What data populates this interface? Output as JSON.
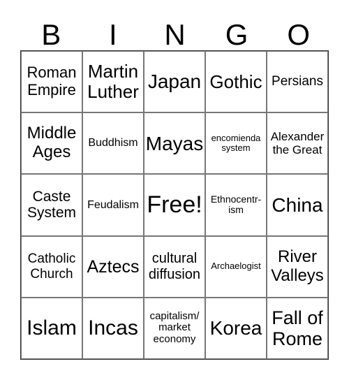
{
  "header": [
    "B",
    "I",
    "N",
    "G",
    "O"
  ],
  "cells": [
    "Roman\nEmpire",
    "Martin\nLuther",
    "Japan",
    "Gothic",
    "Persians",
    "Middle\nAges",
    "Buddhism",
    "Mayas",
    "encomienda\nsystem",
    "Alexander\nthe Great",
    "Caste\nSystem",
    "Feudalism",
    "Free!",
    "Ethnocentr-\nism",
    "China",
    "Catholic\nChurch",
    "Aztecs",
    "cultural\ndiffusion",
    "Archaelogist",
    "River\nValleys",
    "Islam",
    "Incas",
    "capitalism/\nmarket\neconomy",
    "Korea",
    "Fall of\nRome"
  ]
}
